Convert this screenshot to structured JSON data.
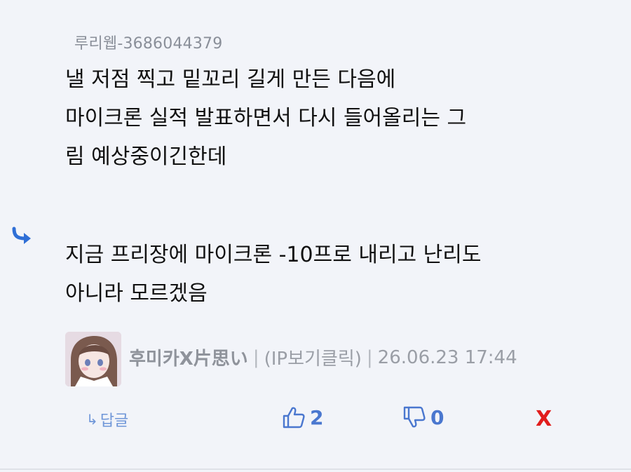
{
  "quote": {
    "author": "루리웹-3686044379",
    "lines": [
      "낼 저점 찍고 밑꼬리 길게 만든 다음에",
      "마이크론 실적 발표하면서 다시 들어올리는 그",
      "림 예상중이긴한데"
    ]
  },
  "reply": {
    "lines": [
      "지금 프리장에 마이크론 -10프로 내리고 난리도",
      "아니라 모르겠음"
    ]
  },
  "meta": {
    "nickname": "후미카X片思い",
    "separator": "|",
    "ip_link": "(IP보기클릭)",
    "timestamp": "26.06.23 17:44"
  },
  "actions": {
    "reply_label": "답글",
    "reply_icon": "↳",
    "like_count": "2",
    "dislike_count": "0",
    "delete_label": "X"
  },
  "colors": {
    "accent": "#4a77cf",
    "delete": "#e11d1d",
    "background": "#f2f4f9"
  },
  "icons": [
    "reply-arrow-icon",
    "thumbs-up-icon",
    "thumbs-down-icon"
  ]
}
